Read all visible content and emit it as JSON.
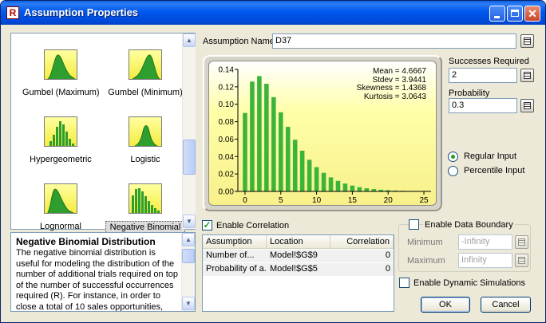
{
  "window": {
    "title": "Assumption Properties",
    "app_icon": "R"
  },
  "gallery": {
    "items": [
      {
        "label": "Gumbel (Maximum)",
        "thumb": "skewed-right-curve"
      },
      {
        "label": "Gumbel (Minimum)",
        "thumb": "skewed-left-curve"
      },
      {
        "label": "Hypergeometric",
        "thumb": "discrete-bars"
      },
      {
        "label": "Logistic",
        "thumb": "bell-curve"
      },
      {
        "label": "Lognormal",
        "thumb": "skewed-right-curve"
      },
      {
        "label": "Negative Binomial",
        "thumb": "discrete-bars",
        "selected": true
      }
    ]
  },
  "description": {
    "title": "Negative Binomial Distribution",
    "lines": [
      "The negative binomial distribution is",
      "useful for modeling the distribution of the",
      "number of additional trials required on top",
      "of the number of successful occurrences",
      "required (R). For instance, in order to",
      "close a total of 10 sales opportunities,"
    ]
  },
  "assumption_name": {
    "label": "Assumption Name",
    "value": "D37"
  },
  "params": {
    "successes": {
      "label": "Successes Required",
      "value": "2"
    },
    "probability": {
      "label": "Probability",
      "value": "0.3"
    }
  },
  "input_mode": {
    "regular": "Regular Input",
    "percentile": "Percentile Input",
    "selected": "regular"
  },
  "stats": {
    "mean": "Mean = 4.6667",
    "stdev": "Stdev = 3.9441",
    "skewness": "Skewness = 1.4368",
    "kurtosis": "Kurtosis = 3.0643"
  },
  "chart_data": {
    "type": "bar",
    "x": [
      0,
      1,
      2,
      3,
      4,
      5,
      6,
      7,
      8,
      9,
      10,
      11,
      12,
      13,
      14,
      15,
      16,
      17,
      18,
      19,
      20,
      21,
      22,
      23,
      24,
      25
    ],
    "values": [
      0.09,
      0.126,
      0.1323,
      0.1235,
      0.1081,
      0.0908,
      0.0741,
      0.0593,
      0.0467,
      0.0363,
      0.0279,
      0.0213,
      0.0161,
      0.0121,
      0.009,
      0.0067,
      0.0049,
      0.0036,
      0.0027,
      0.0019,
      0.0014,
      0.001,
      0.0007,
      0.0005,
      0.0004,
      0.0003
    ],
    "xlim": [
      -1,
      26
    ],
    "ylim": [
      0,
      0.14
    ],
    "xticks": [
      "0",
      "5",
      "10",
      "15",
      "20",
      "25"
    ],
    "yticks": [
      "0.00",
      "0.02",
      "0.04",
      "0.06",
      "0.08",
      "0.10",
      "0.12",
      "0.14"
    ],
    "bar_color": "#3cb43c",
    "grid": false
  },
  "correlation": {
    "enable_label": "Enable Correlation",
    "enabled": true,
    "columns": [
      "Assumption",
      "Location",
      "Correlation"
    ],
    "rows": [
      {
        "assumption": "Number of...",
        "location": "Model!$G$9",
        "correlation": "0"
      },
      {
        "assumption": "Probability of a...",
        "location": "Model!$G$5",
        "correlation": "0"
      }
    ]
  },
  "data_boundary": {
    "enable_label": "Enable Data Boundary",
    "enabled": false,
    "minimum_label": "Minimum",
    "minimum_value": "-Infinity",
    "maximum_label": "Maximum",
    "maximum_value": "Infinity"
  },
  "dynamic_simulations": {
    "label": "Enable Dynamic Simulations",
    "enabled": false
  },
  "buttons": {
    "ok": "OK",
    "cancel": "Cancel"
  },
  "colors": {
    "title_bar": "#0058ee",
    "chart_background": "#ffffa8",
    "bar": "#3cb43c"
  }
}
